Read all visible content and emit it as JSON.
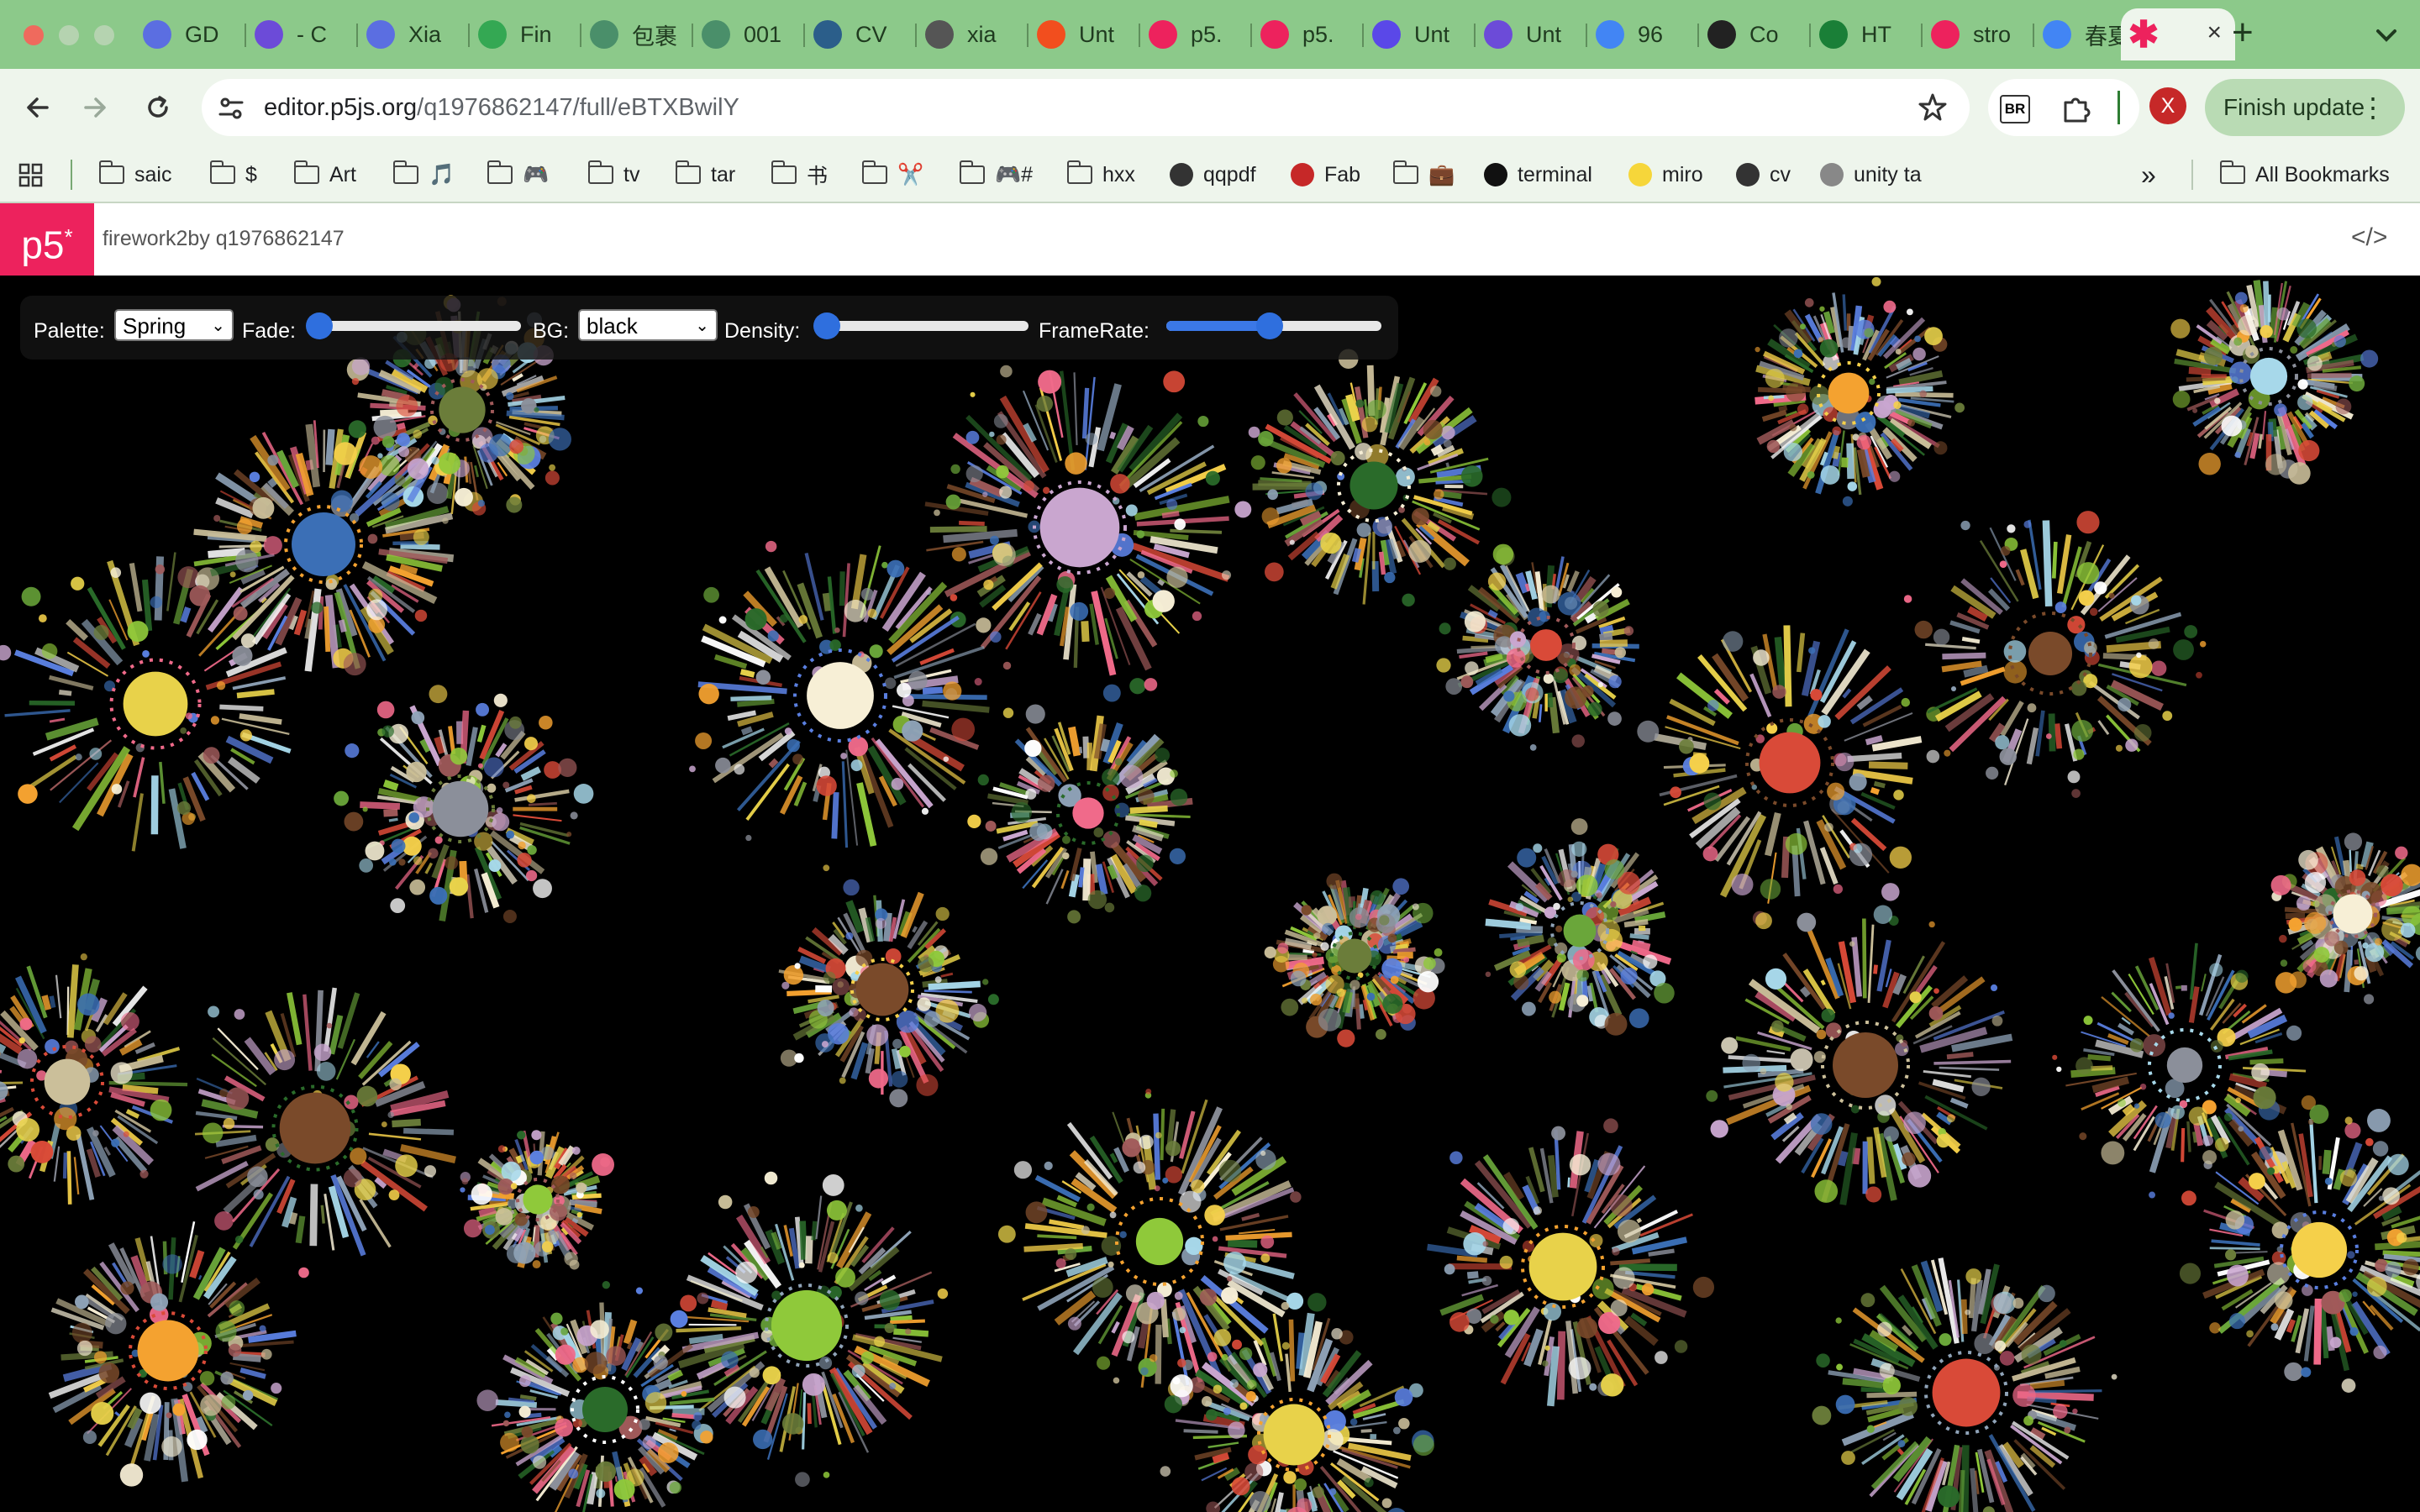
{
  "browser": {
    "tabs": [
      {
        "label": "GD",
        "icon": "document-icon",
        "color": "#5b6ee1"
      },
      {
        "label": "- C",
        "icon": "chat-icon",
        "color": "#6c4bd8"
      },
      {
        "label": "Xia",
        "icon": "document-icon",
        "color": "#5b6ee1"
      },
      {
        "label": "Fin",
        "icon": "drive-icon",
        "color": "#34a853"
      },
      {
        "label": "包裹",
        "icon": "globe-badge-icon",
        "color": "#4a8f6a"
      },
      {
        "label": "001",
        "icon": "globe-badge-icon",
        "color": "#4a8f6a"
      },
      {
        "label": "CV",
        "icon": "globe-icon",
        "color": "#2b5e8a"
      },
      {
        "label": "xia",
        "icon": "compass-icon",
        "color": "#555555"
      },
      {
        "label": "Unt",
        "icon": "figma-icon",
        "color": "#f24e1e"
      },
      {
        "label": "p5.",
        "icon": "asterisk-icon",
        "color": "#ed225d"
      },
      {
        "label": "p5.",
        "icon": "asterisk-icon",
        "color": "#ed225d"
      },
      {
        "label": "Unt",
        "icon": "video-icon",
        "color": "#5a48e8"
      },
      {
        "label": "Unt",
        "icon": "chat-icon",
        "color": "#6c4bd8"
      },
      {
        "label": "96",
        "icon": "google-icon",
        "color": "#4285f4"
      },
      {
        "label": "Co",
        "icon": "openai-icon",
        "color": "#222222"
      },
      {
        "label": "HT",
        "icon": "w-icon",
        "color": "#1a7f37"
      },
      {
        "label": "stro",
        "icon": "asterisk-icon",
        "color": "#ed225d"
      },
      {
        "label": "春夏",
        "icon": "google-icon",
        "color": "#4285f4"
      }
    ],
    "active_tab_close": "×",
    "new_tab": "+",
    "url_host": "editor.p5js.org",
    "url_path": "/q1976862147/full/eBTXBwilY",
    "extension_badge": "BR",
    "profile_initial": "X",
    "finish_update_label": "Finish update",
    "more_menu": "⋮"
  },
  "bookmarks": {
    "items": [
      {
        "label": "saic",
        "icon": "folder-icon"
      },
      {
        "label": "$",
        "icon": "folder-icon"
      },
      {
        "label": "Art",
        "icon": "folder-icon"
      },
      {
        "label": "🎵",
        "icon": "folder-icon"
      },
      {
        "label": "🎮",
        "icon": "folder-icon"
      },
      {
        "label": "tv",
        "icon": "folder-icon"
      },
      {
        "label": "tar",
        "icon": "folder-icon"
      },
      {
        "label": "书",
        "icon": "folder-icon"
      },
      {
        "label": "✂️",
        "icon": "folder-icon"
      },
      {
        "label": "🎮#",
        "icon": "folder-icon"
      },
      {
        "label": "hxx",
        "icon": "folder-icon"
      },
      {
        "label": "qqpdf",
        "icon": "globe-icon"
      },
      {
        "label": "Fab",
        "icon": "fab-icon"
      },
      {
        "label": "💼",
        "icon": "folder-icon"
      },
      {
        "label": "terminal",
        "icon": "github-icon"
      },
      {
        "label": "miro",
        "icon": "miro-icon"
      },
      {
        "label": "cv",
        "icon": "globe-icon"
      },
      {
        "label": "unity ta",
        "icon": "unity-icon"
      }
    ],
    "overflow": "»",
    "all_bookmarks": "All Bookmarks"
  },
  "p5": {
    "logo": "p5",
    "logo_mark": "*",
    "sketch_title": "firework2by q1976862147",
    "code_toggle": "</>"
  },
  "controls": {
    "palette_label": "Palette:",
    "palette_value": "Spring",
    "fade_label": "Fade:",
    "fade_value": 0.0,
    "bg_label": "BG:",
    "bg_value": "black",
    "density_label": "Density:",
    "density_value": 0.0,
    "framerate_label": "FrameRate:",
    "framerate_value": 0.48
  },
  "palette_colors": [
    "#f4a230",
    "#f5d04a",
    "#a7d8ea",
    "#8fc93a",
    "#d94a38",
    "#f7efd6",
    "#c9a6cf",
    "#6b7d3a",
    "#8b8f9a",
    "#3b6fb6",
    "#7a4a2a",
    "#2a6b2a",
    "#f06a8a",
    "#cbbf9a",
    "#ffffff",
    "#e8d24a",
    "#8fa3b8",
    "#a05a5a",
    "#5a7fe0",
    "#6aa63a"
  ]
}
